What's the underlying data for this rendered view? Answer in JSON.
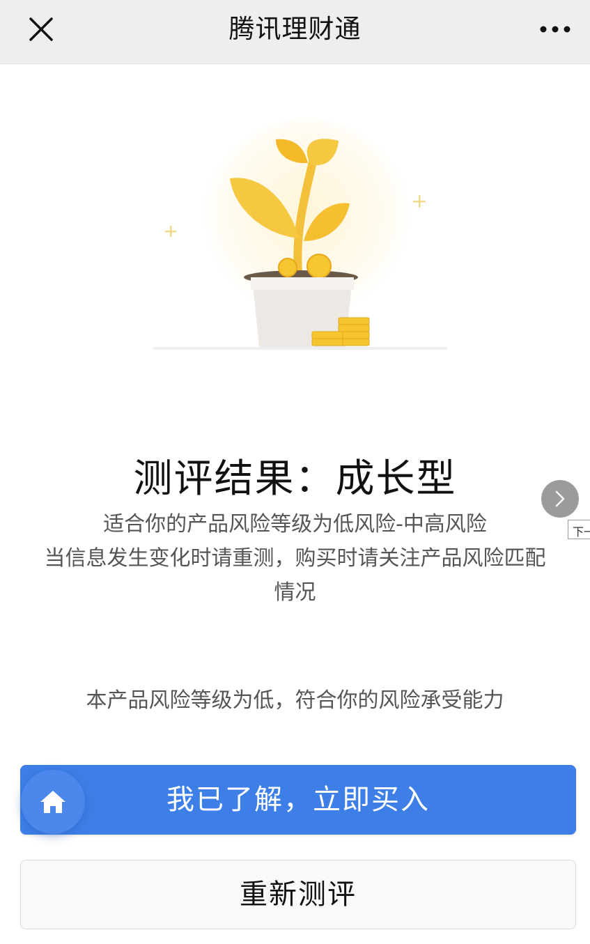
{
  "nav": {
    "title": "腾讯理财通",
    "close_icon": "close-icon",
    "more_icon": "more-dots-icon"
  },
  "illustration": {
    "icon": "plant-coins-illustration",
    "colors": {
      "leaf": "#f5c842",
      "pot": "#e9e5e0",
      "coin": "#f6c631"
    }
  },
  "result": {
    "title": "测评结果：成长型",
    "desc_lines": [
      "适合你的产品风险等级为低风险-中高风险",
      "当信息发生变化时请重测，购买时请关注产品风险匹配",
      "情况"
    ]
  },
  "next": {
    "icon": "chevron-right-icon",
    "tooltip": "下一"
  },
  "risk_note": "本产品风险等级为低，符合你的风险承受能力",
  "buttons": {
    "buy_label": "我已了解，立即买入",
    "retest_label": "重新测评",
    "home_icon": "home-icon"
  },
  "colors": {
    "primary": "#3d7fe6",
    "text_secondary": "#555555"
  }
}
